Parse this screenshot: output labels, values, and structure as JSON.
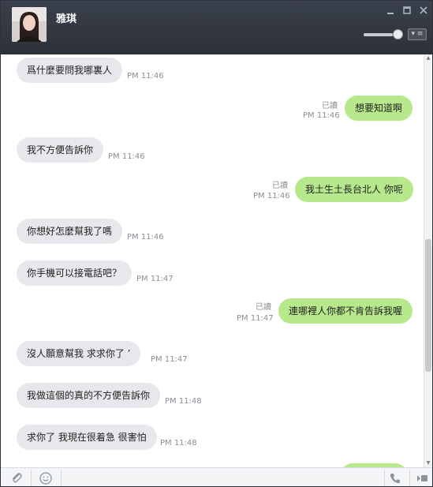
{
  "header": {
    "contact_name": "雅琪",
    "avatar_icon": "contact-avatar-photo",
    "controls": [
      "minimize-icon",
      "maximize-icon",
      "close-icon"
    ],
    "zoom_slider_level": 0.8
  },
  "messages": [
    {
      "side": "left",
      "text": "爲什麼要問我哪裏人",
      "time": "PM 11:46"
    },
    {
      "side": "right",
      "text": "想要知道啊",
      "time": "PM 11:46",
      "read": "已讀"
    },
    {
      "side": "left",
      "text": "我不方便告訴你",
      "time": "PM 11:46"
    },
    {
      "side": "right",
      "text": "我土生土長台北人 你呢",
      "time": "PM 11:46",
      "read": "已讀"
    },
    {
      "side": "left",
      "text": "你想好怎麼幫我了嗎",
      "time": "PM 11:46"
    },
    {
      "side": "left",
      "text": "你手機可以接電話吧？",
      "time": "PM 11:47"
    },
    {
      "side": "right",
      "text": "連哪裡人你都不肯告訴我喔",
      "time": "PM 11:47",
      "read": "已讀"
    },
    {
      "side": "left",
      "text": "沒人願意幫我  求求你了 ’",
      "time": "PM 11:47"
    },
    {
      "side": "left",
      "text": "我做這個的真的不方便告訴你",
      "time": "PM 11:48"
    },
    {
      "side": "left",
      "text": "求你了 我現在很着急 很害怕",
      "time": "PM 11:48"
    }
  ],
  "footer": {
    "icons": [
      "attachment-icon",
      "emoji-icon",
      "phone-icon",
      "video-call-icon"
    ]
  },
  "colors": {
    "header_bg": "#30353f",
    "bubble_left": "#e6e8eb",
    "bubble_right": "#b7e88c",
    "timestamp": "#8a8f96"
  }
}
